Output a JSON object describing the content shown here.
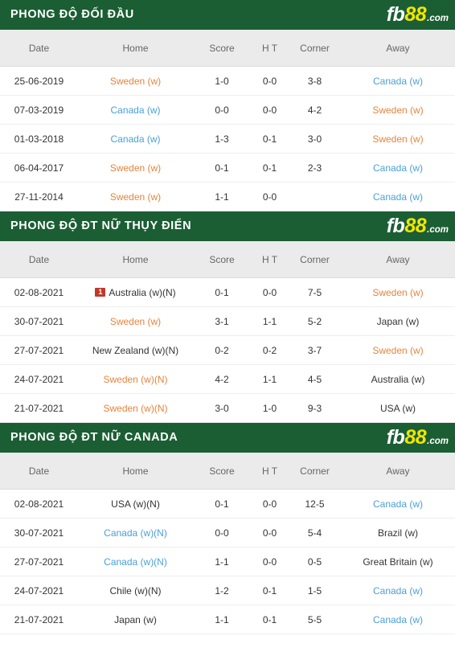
{
  "brand": {
    "logo_fb": "fb",
    "logo_88": "88",
    "logo_com": ".com",
    "green": "#1b5e34",
    "yellow": "#f2e500",
    "score_red": "#c9302c",
    "team_orange": "#e8833a",
    "team_blue": "#4a9fd8",
    "badge_red": "#c0392b"
  },
  "columns": {
    "date": "Date",
    "home": "Home",
    "score": "Score",
    "ht": "H T",
    "corner": "Corner",
    "away": "Away"
  },
  "sections": [
    {
      "title": "PHONG ĐỘ ĐỐI ĐẦU",
      "rows": [
        {
          "date": "25-06-2019",
          "home": "Sweden (w)",
          "home_color": "orange",
          "home_badge": "",
          "score": "1-0",
          "ht": "0-0",
          "corner": "3-8",
          "away": "Canada (w)",
          "away_color": "blue"
        },
        {
          "date": "07-03-2019",
          "home": "Canada (w)",
          "home_color": "blue",
          "home_badge": "",
          "score": "0-0",
          "ht": "0-0",
          "corner": "4-2",
          "away": "Sweden (w)",
          "away_color": "orange"
        },
        {
          "date": "01-03-2018",
          "home": "Canada (w)",
          "home_color": "blue",
          "home_badge": "",
          "score": "1-3",
          "ht": "0-1",
          "corner": "3-0",
          "away": "Sweden (w)",
          "away_color": "orange"
        },
        {
          "date": "06-04-2017",
          "home": "Sweden (w)",
          "home_color": "orange",
          "home_badge": "",
          "score": "0-1",
          "ht": "0-1",
          "corner": "2-3",
          "away": "Canada (w)",
          "away_color": "blue"
        },
        {
          "date": "27-11-2014",
          "home": "Sweden (w)",
          "home_color": "orange",
          "home_badge": "",
          "score": "1-1",
          "ht": "0-0",
          "corner": "",
          "away": "Canada (w)",
          "away_color": "blue"
        }
      ]
    },
    {
      "title": "PHONG ĐỘ ĐT NỮ THỤY ĐIỂN",
      "rows": [
        {
          "date": "02-08-2021",
          "home": "Australia (w)(N)",
          "home_color": "neutral",
          "home_badge": "1",
          "score": "0-1",
          "ht": "0-0",
          "corner": "7-5",
          "away": "Sweden (w)",
          "away_color": "orange"
        },
        {
          "date": "30-07-2021",
          "home": "Sweden (w)",
          "home_color": "orange",
          "home_badge": "",
          "score": "3-1",
          "ht": "1-1",
          "corner": "5-2",
          "away": "Japan (w)",
          "away_color": "neutral"
        },
        {
          "date": "27-07-2021",
          "home": "New Zealand (w)(N)",
          "home_color": "neutral",
          "home_badge": "",
          "score": "0-2",
          "ht": "0-2",
          "corner": "3-7",
          "away": "Sweden (w)",
          "away_color": "orange"
        },
        {
          "date": "24-07-2021",
          "home": "Sweden (w)(N)",
          "home_color": "orange",
          "home_badge": "",
          "score": "4-2",
          "ht": "1-1",
          "corner": "4-5",
          "away": "Australia (w)",
          "away_color": "neutral"
        },
        {
          "date": "21-07-2021",
          "home": "Sweden (w)(N)",
          "home_color": "orange",
          "home_badge": "",
          "score": "3-0",
          "ht": "1-0",
          "corner": "9-3",
          "away": "USA (w)",
          "away_color": "neutral"
        }
      ]
    },
    {
      "title": "PHONG ĐỘ ĐT NỮ CANADA",
      "rows": [
        {
          "date": "02-08-2021",
          "home": "USA (w)(N)",
          "home_color": "neutral",
          "home_badge": "",
          "score": "0-1",
          "ht": "0-0",
          "corner": "12-5",
          "away": "Canada (w)",
          "away_color": "blue"
        },
        {
          "date": "30-07-2021",
          "home": "Canada (w)(N)",
          "home_color": "blue",
          "home_badge": "",
          "score": "0-0",
          "ht": "0-0",
          "corner": "5-4",
          "away": "Brazil (w)",
          "away_color": "neutral"
        },
        {
          "date": "27-07-2021",
          "home": "Canada (w)(N)",
          "home_color": "blue",
          "home_badge": "",
          "score": "1-1",
          "ht": "0-0",
          "corner": "0-5",
          "away": "Great Britain (w)",
          "away_color": "neutral"
        },
        {
          "date": "24-07-2021",
          "home": "Chile (w)(N)",
          "home_color": "neutral",
          "home_badge": "",
          "score": "1-2",
          "ht": "0-1",
          "corner": "1-5",
          "away": "Canada (w)",
          "away_color": "blue"
        },
        {
          "date": "21-07-2021",
          "home": "Japan (w)",
          "home_color": "neutral",
          "home_badge": "",
          "score": "1-1",
          "ht": "0-1",
          "corner": "5-5",
          "away": "Canada (w)",
          "away_color": "blue"
        }
      ]
    }
  ]
}
